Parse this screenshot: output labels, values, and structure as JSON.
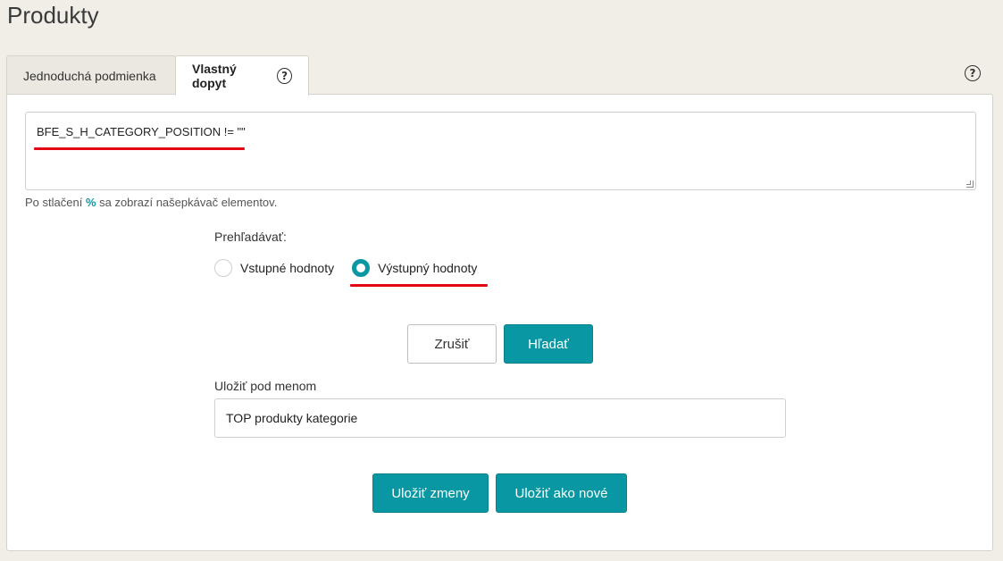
{
  "page": {
    "title": "Produkty"
  },
  "tabs": {
    "simple_label": "Jednoduchá podmienka",
    "custom_label": "Vlastný dopyt",
    "help_glyph": "?"
  },
  "query": {
    "value": "BFE_S_H_CATEGORY_POSITION != \"\"",
    "hint_before": "Po stlačení ",
    "hint_key": "%",
    "hint_after": " sa zobrazí našepkávač elementov."
  },
  "search_in": {
    "label": "Prehľadávať:",
    "options": [
      {
        "label": "Vstupné hodnoty",
        "checked": false
      },
      {
        "label": "Výstupný hodnoty",
        "checked": true
      }
    ]
  },
  "actions": {
    "cancel_label": "Zrušiť",
    "search_label": "Hľadať"
  },
  "save": {
    "label": "Uložiť pod menom",
    "value": "TOP produkty kategorie",
    "save_changes_label": "Uložiť zmeny",
    "save_new_label": "Uložiť ako nové"
  },
  "colors": {
    "accent": "#0a97a4",
    "annotation_red": "#e30613",
    "page_bg": "#f1eee8"
  }
}
